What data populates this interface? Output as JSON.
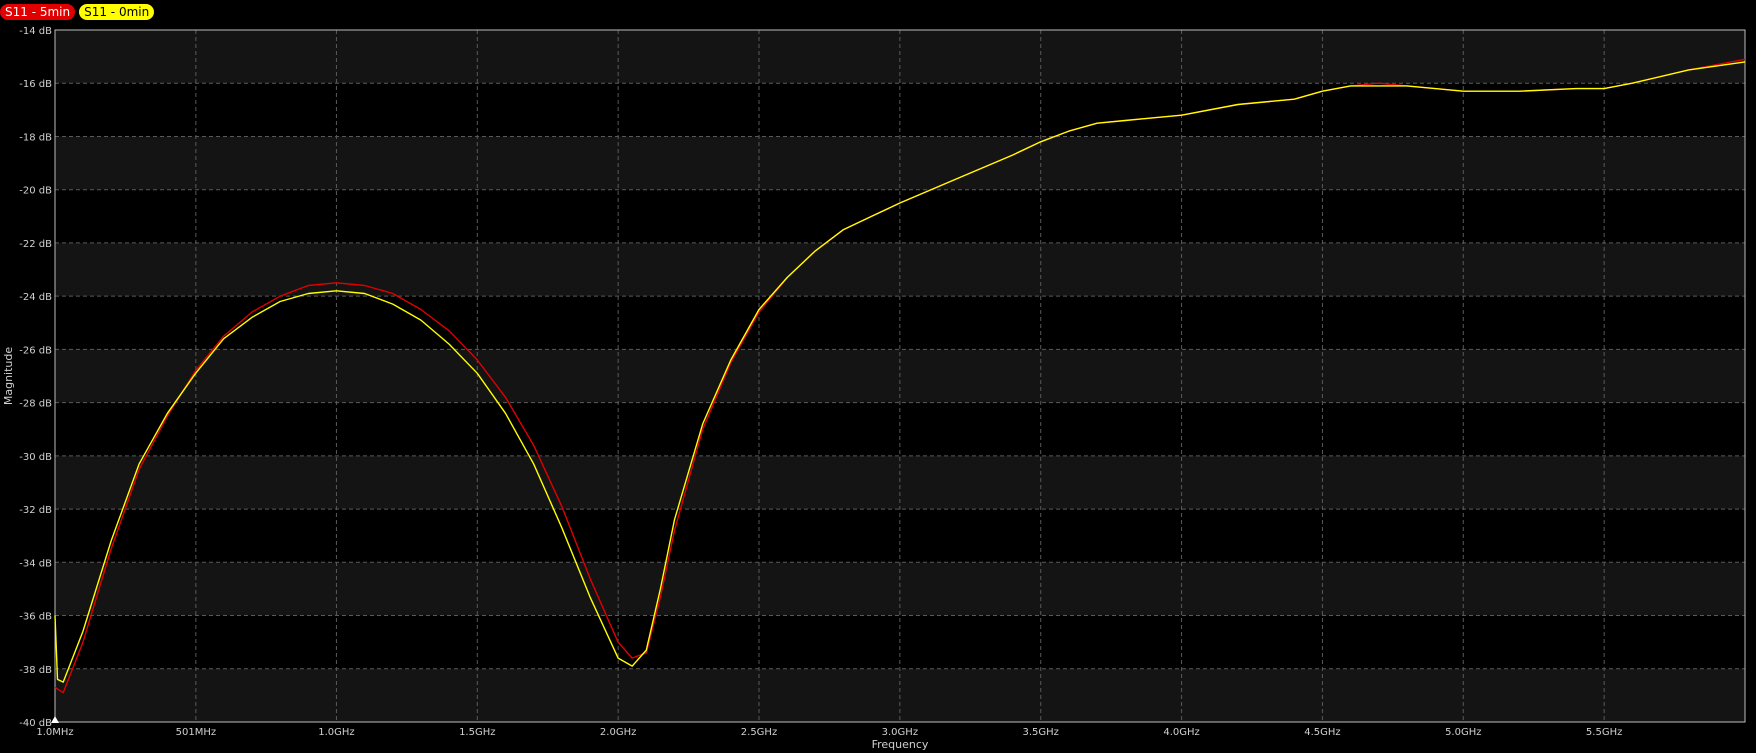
{
  "chart_data": {
    "type": "line",
    "title": "",
    "xlabel": "Frequency",
    "ylabel": "Magnitude",
    "xlim": [
      1,
      6000
    ],
    "ylim": [
      -40,
      -14
    ],
    "grid": true,
    "legend_position": "top-left",
    "x_ticks": [
      {
        "value": 1,
        "label": "1.0MHz"
      },
      {
        "value": 501,
        "label": "501MHz"
      },
      {
        "value": 1000,
        "label": "1.0GHz"
      },
      {
        "value": 1500,
        "label": "1.5GHz"
      },
      {
        "value": 2000,
        "label": "2.0GHz"
      },
      {
        "value": 2500,
        "label": "2.5GHz"
      },
      {
        "value": 3000,
        "label": "3.0GHz"
      },
      {
        "value": 3500,
        "label": "3.5GHz"
      },
      {
        "value": 4000,
        "label": "4.0GHz"
      },
      {
        "value": 4500,
        "label": "4.5GHz"
      },
      {
        "value": 5000,
        "label": "5.0GHz"
      },
      {
        "value": 5500,
        "label": "5.5GHz"
      }
    ],
    "y_ticks": [
      {
        "value": -14,
        "label": "-14 dB"
      },
      {
        "value": -16,
        "label": "-16 dB"
      },
      {
        "value": -18,
        "label": "-18 dB"
      },
      {
        "value": -20,
        "label": "-20 dB"
      },
      {
        "value": -22,
        "label": "-22 dB"
      },
      {
        "value": -24,
        "label": "-24 dB"
      },
      {
        "value": -26,
        "label": "-26 dB"
      },
      {
        "value": -28,
        "label": "-28 dB"
      },
      {
        "value": -30,
        "label": "-30 dB"
      },
      {
        "value": -32,
        "label": "-32 dB"
      },
      {
        "value": -34,
        "label": "-34 dB"
      },
      {
        "value": -36,
        "label": "-36 dB"
      },
      {
        "value": -38,
        "label": "-38 dB"
      },
      {
        "value": -40,
        "label": "-40 dB"
      }
    ],
    "series": [
      {
        "name": "S11 - 5min",
        "color": "#e00000",
        "x": [
          1,
          30,
          100,
          200,
          300,
          400,
          500,
          600,
          700,
          800,
          900,
          1000,
          1100,
          1200,
          1300,
          1400,
          1500,
          1600,
          1700,
          1800,
          1900,
          2000,
          2050,
          2100,
          2150,
          2200,
          2300,
          2400,
          2500,
          2600,
          2700,
          2800,
          2900,
          3000,
          3200,
          3400,
          3500,
          3600,
          3700,
          3800,
          3900,
          4000,
          4200,
          4400,
          4500,
          4600,
          4700,
          4800,
          5000,
          5200,
          5400,
          5500,
          5600,
          5800,
          6000
        ],
        "y": [
          -38.7,
          -38.9,
          -37.0,
          -33.5,
          -30.5,
          -28.5,
          -26.8,
          -25.5,
          -24.6,
          -24.0,
          -23.6,
          -23.5,
          -23.6,
          -23.9,
          -24.5,
          -25.3,
          -26.4,
          -27.8,
          -29.6,
          -31.9,
          -34.6,
          -37.0,
          -37.6,
          -37.4,
          -35.3,
          -32.8,
          -29.0,
          -26.5,
          -24.6,
          -23.3,
          -22.3,
          -21.5,
          -21.0,
          -20.5,
          -19.6,
          -18.7,
          -18.2,
          -17.8,
          -17.5,
          -17.4,
          -17.3,
          -17.2,
          -16.8,
          -16.6,
          -16.3,
          -16.1,
          -16.0,
          -16.1,
          -16.3,
          -16.3,
          -16.2,
          -16.2,
          -16.0,
          -15.5,
          -15.1
        ]
      },
      {
        "name": "S11 - 0min",
        "color": "#ffff00",
        "x": [
          1,
          10,
          30,
          100,
          200,
          300,
          400,
          500,
          600,
          700,
          800,
          900,
          1000,
          1100,
          1200,
          1300,
          1400,
          1500,
          1600,
          1700,
          1800,
          1900,
          2000,
          2050,
          2100,
          2150,
          2200,
          2300,
          2400,
          2500,
          2600,
          2700,
          2800,
          2900,
          3000,
          3200,
          3400,
          3500,
          3600,
          3700,
          3800,
          3900,
          4000,
          4200,
          4400,
          4500,
          4600,
          4700,
          4800,
          5000,
          5200,
          5400,
          5500,
          5600,
          5800,
          6000
        ],
        "y": [
          -36.0,
          -38.4,
          -38.5,
          -36.6,
          -33.2,
          -30.3,
          -28.4,
          -26.9,
          -25.6,
          -24.8,
          -24.2,
          -23.9,
          -23.8,
          -23.9,
          -24.3,
          -24.9,
          -25.8,
          -26.9,
          -28.4,
          -30.3,
          -32.7,
          -35.3,
          -37.6,
          -37.9,
          -37.3,
          -35.0,
          -32.4,
          -28.8,
          -26.4,
          -24.5,
          -23.3,
          -22.3,
          -21.5,
          -21.0,
          -20.5,
          -19.6,
          -18.7,
          -18.2,
          -17.8,
          -17.5,
          -17.4,
          -17.3,
          -17.2,
          -16.8,
          -16.6,
          -16.3,
          -16.1,
          -16.1,
          -16.1,
          -16.3,
          -16.3,
          -16.2,
          -16.2,
          -16.0,
          -15.5,
          -15.2
        ]
      }
    ]
  }
}
